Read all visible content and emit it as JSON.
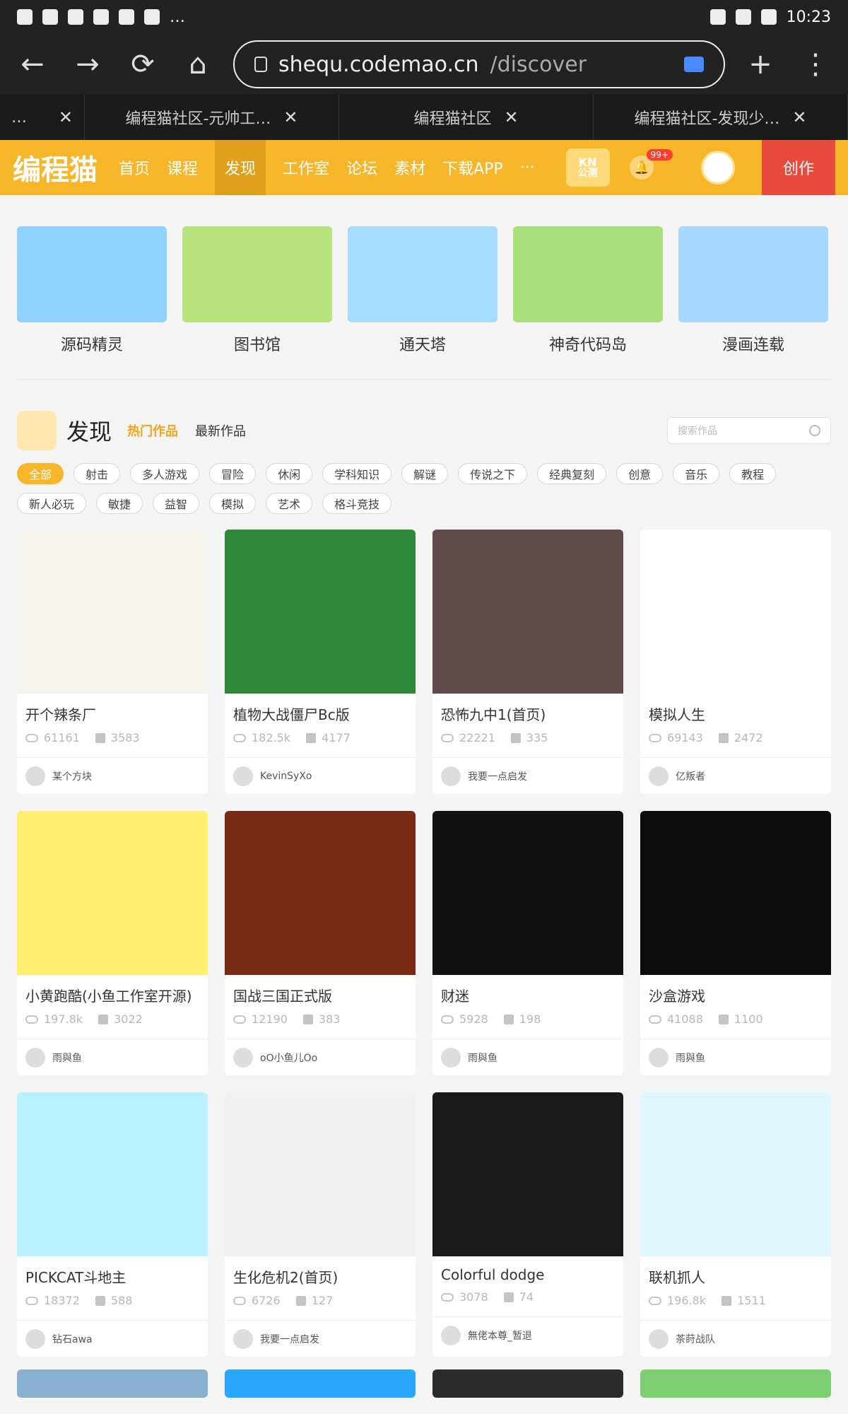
{
  "status": {
    "time": "10:23",
    "more": "…"
  },
  "browser": {
    "url_host": "shequ.codemao.cn",
    "url_path": "/discover",
    "tabs": [
      {
        "title": "…"
      },
      {
        "title": "编程猫社区-元帅工…"
      },
      {
        "title": "编程猫社区"
      },
      {
        "title": "编程猫社区-发现少…"
      }
    ]
  },
  "site": {
    "logo": "编程猫",
    "nav": [
      "首页",
      "课程",
      "发现",
      "工作室",
      "论坛",
      "素材",
      "下载APP",
      "···"
    ],
    "active_nav": "发现",
    "kn_label": "KN",
    "kn_sub": "公测",
    "badge": "99+",
    "create_label": "创作"
  },
  "banner": [
    {
      "title": "源码精灵",
      "color": "#8fd1ff"
    },
    {
      "title": "图书馆",
      "color": "#b7e27c"
    },
    {
      "title": "通天塔",
      "color": "#a6ddff"
    },
    {
      "title": "神奇代码岛",
      "color": "#a9e07c"
    },
    {
      "title": "漫画连载",
      "color": "#a6d7ff"
    }
  ],
  "discover": {
    "title": "发现",
    "tab_hot": "热门作品",
    "tab_new": "最新作品",
    "search_placeholder": "搜索作品"
  },
  "categories": [
    "全部",
    "射击",
    "多人游戏",
    "冒险",
    "休闲",
    "学科知识",
    "解谜",
    "传说之下",
    "经典复刻",
    "创意",
    "音乐",
    "教程",
    "新人必玩",
    "敏捷",
    "益智",
    "模拟",
    "艺术",
    "格斗竞技"
  ],
  "works": [
    {
      "title": "开个辣条厂",
      "views": "61161",
      "likes": "3583",
      "author": "某个方块",
      "thumb": "#f6f2ee"
    },
    {
      "title": "植物大战僵尸Bc版",
      "views": "182.5k",
      "likes": "4177",
      "author": "KevinSyXo",
      "thumb": "#2e8a3a"
    },
    {
      "title": "恐怖九中1(首页)",
      "views": "22221",
      "likes": "335",
      "author": "我要一点启发",
      "thumb": "#5f4b4b"
    },
    {
      "title": "模拟人生",
      "views": "69143",
      "likes": "2472",
      "author": "亿叛者",
      "thumb": "#ffffff"
    },
    {
      "title": "小黄跑酷(小鱼工作室开源)",
      "views": "197.8k",
      "likes": "3022",
      "author": "雨與鱼",
      "thumb": "#ffef6e"
    },
    {
      "title": "国战三国正式版",
      "views": "12190",
      "likes": "383",
      "author": "oO小鱼儿Oo",
      "thumb": "#7a2a13"
    },
    {
      "title": "财迷",
      "views": "5928",
      "likes": "198",
      "author": "雨與鱼",
      "thumb": "#111111"
    },
    {
      "title": "沙盒游戏",
      "views": "41088",
      "likes": "1100",
      "author": "雨與鱼",
      "thumb": "#0c0c0c"
    },
    {
      "title": "PICKCAT斗地主",
      "views": "18372",
      "likes": "588",
      "author": "钻石awa",
      "thumb": "#b8f1ff"
    },
    {
      "title": "生化危机2(首页)",
      "views": "6726",
      "likes": "127",
      "author": "我要一点启发",
      "thumb": "#f0f0f0"
    },
    {
      "title": "Colorful dodge",
      "views": "3078",
      "likes": "74",
      "author": "無佬本尊_暂退",
      "thumb": "#1a1a1a"
    },
    {
      "title": "联机抓人",
      "views": "196.8k",
      "likes": "1511",
      "author": "茶莳战队",
      "thumb": "#dff6ff"
    }
  ],
  "bottom_strips": [
    {
      "color": "#88b1cf"
    },
    {
      "color": "#29a6ff"
    },
    {
      "color": "#2b2b2b"
    },
    {
      "color": "#7ccf71"
    }
  ]
}
